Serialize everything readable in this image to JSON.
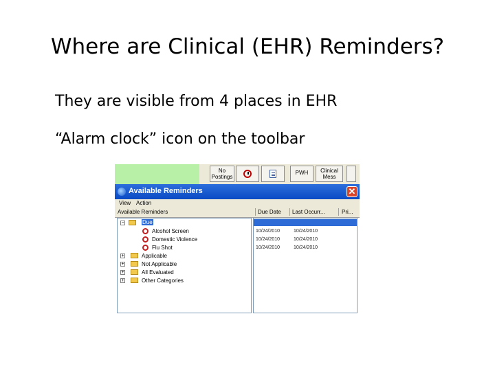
{
  "slide": {
    "title": "Where are Clinical (EHR) Reminders?",
    "bullets": [
      "They are visible from 4 places in EHR",
      "“Alarm clock” icon on the toolbar"
    ]
  },
  "toolbar": {
    "notifications_label": "No Postings",
    "alarm_icon": "alarm-clock-icon",
    "note_icon": "note-icon",
    "pwh_label": "PWH",
    "crisis_label": "Clinical Mess"
  },
  "window": {
    "title": "Available Reminders",
    "close_glyph": "✕",
    "menu": [
      "View",
      "Action"
    ],
    "columns": [
      "Available Reminders",
      "Due Date",
      "Last Occurr...",
      "Pri..."
    ],
    "tree": [
      {
        "label": "Due",
        "expander": "−",
        "type": "folder",
        "selected": true
      },
      {
        "label": "Alcohol Screen",
        "type": "reminder"
      },
      {
        "label": "Domestic Violence",
        "type": "reminder"
      },
      {
        "label": "Flu Shot",
        "type": "reminder"
      },
      {
        "label": "Applicable",
        "expander": "+",
        "type": "folder"
      },
      {
        "label": "Not Applicable",
        "expander": "+",
        "type": "folder"
      },
      {
        "label": "All Evaluated",
        "expander": "+",
        "type": "folder"
      },
      {
        "label": "Other Categories",
        "expander": "+",
        "type": "folder"
      }
    ],
    "rows": [
      {
        "due": "10/24/2010",
        "last": "10/24/2010"
      },
      {
        "due": "10/24/2010",
        "last": "10/24/2010"
      },
      {
        "due": "10/24/2010",
        "last": "10/24/2010"
      }
    ]
  },
  "colors": {
    "title_bar": "#0a4ac4",
    "selection": "#2e6bd6",
    "toolbar_green": "#b8f0a8"
  }
}
